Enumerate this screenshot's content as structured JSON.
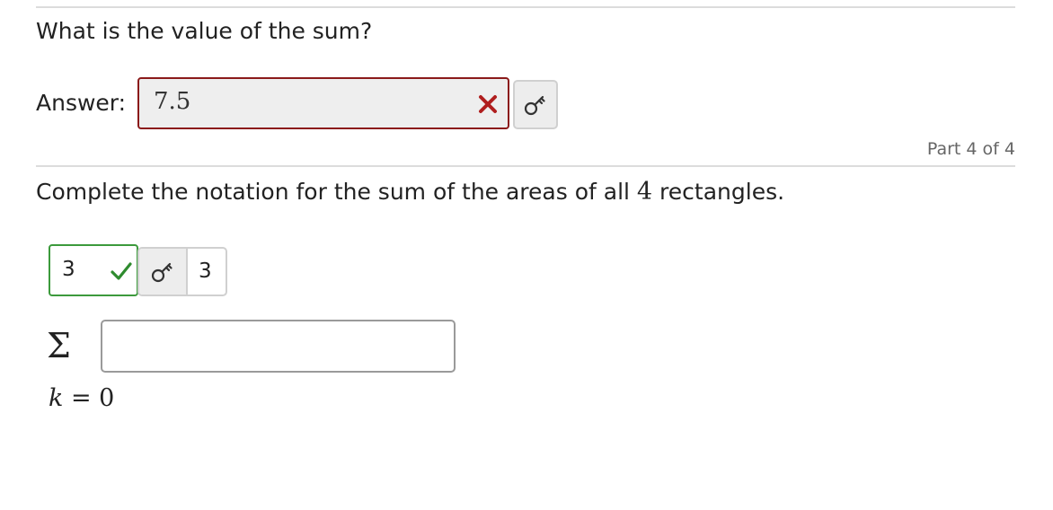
{
  "part_one": {
    "question": "What is the value of the sum?",
    "answer_label": "Answer:",
    "answer_value": "7.5",
    "status": "incorrect"
  },
  "part_label": "Part 4 of 4",
  "part_four": {
    "question_before": "Complete the notation for the sum of the areas of all ",
    "question_number": "4",
    "question_after": " rectangles.",
    "upper_limit_value": "3",
    "upper_limit_status": "correct",
    "upper_limit_shown": "3",
    "sigma_symbol": "Σ",
    "summand_value": "",
    "lower_limit_var": "k",
    "lower_limit_eq": " = ",
    "lower_limit_value": "0"
  },
  "colors": {
    "incorrect": "#8b1a1a",
    "correct": "#3c9a3c",
    "wrong_mark": "#b01e1e",
    "check_mark": "#2e8b2e"
  },
  "icons": {
    "wrong": "x-mark-icon",
    "check": "check-mark-icon",
    "key": "answer-key-icon"
  }
}
